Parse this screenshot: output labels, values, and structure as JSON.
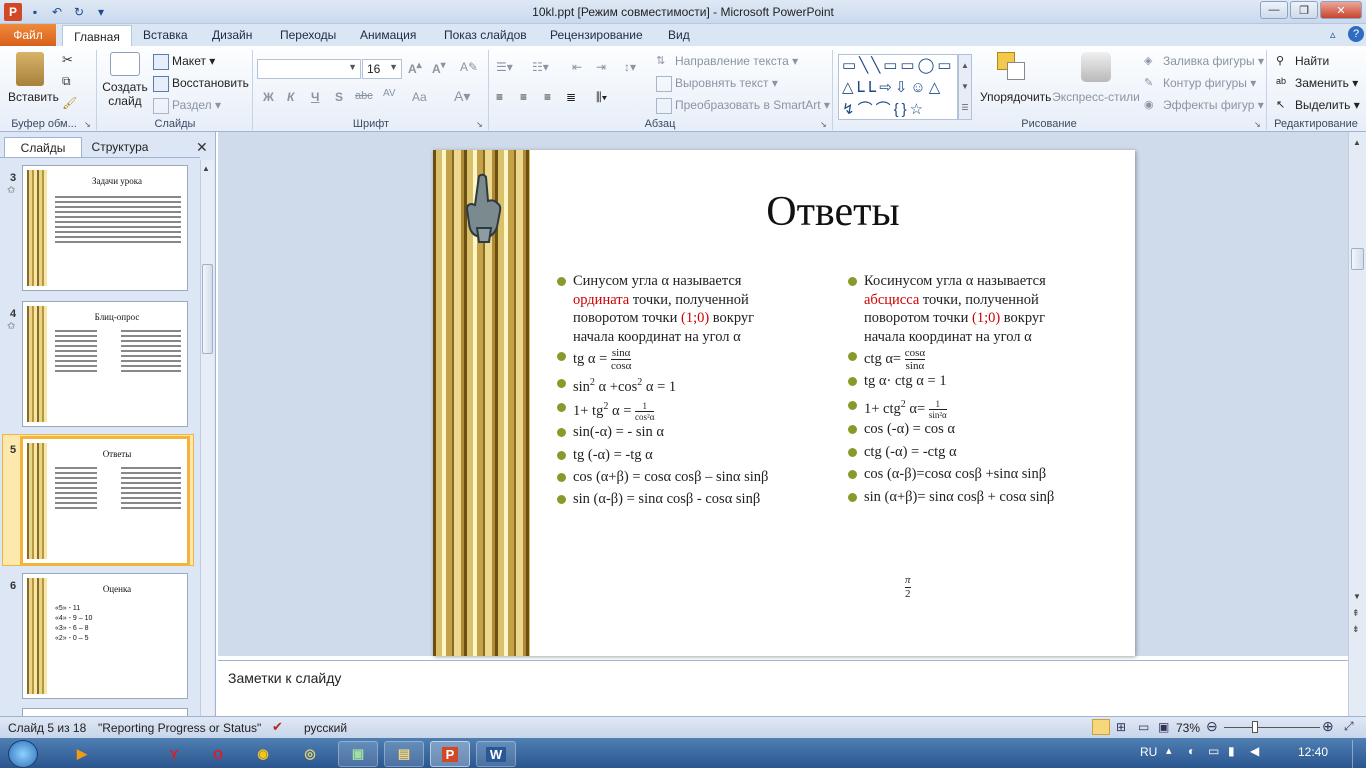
{
  "window": {
    "title": "10kl.ppt [Режим совместимости] - Microsoft PowerPoint"
  },
  "tabs": {
    "file": "Файл",
    "home": "Главная",
    "insert": "Вставка",
    "design": "Дизайн",
    "transitions": "Переходы",
    "animation": "Анимация",
    "slideshow": "Показ слайдов",
    "review": "Рецензирование",
    "view": "Вид"
  },
  "ribbon": {
    "clipboard": {
      "paste": "Вставить",
      "label": "Буфер обм..."
    },
    "slides": {
      "new_slide_1": "Создать",
      "new_slide_2": "слайд",
      "layout": "Макет",
      "reset": "Восстановить",
      "section": "Раздел",
      "label": "Слайды"
    },
    "font": {
      "size": "16",
      "bold": "Ж",
      "italic": "К",
      "underline": "Ч",
      "shadow": "S",
      "strike": "abc",
      "spacing": "AV",
      "case": "Aa",
      "label": "Шрифт"
    },
    "paragraph": {
      "text_direction": "Направление текста",
      "align_text": "Выровнять текст",
      "smartart": "Преобразовать в SmartArt",
      "label": "Абзац"
    },
    "drawing": {
      "arrange": "Упорядочить",
      "quick_styles": "Экспресс-стили",
      "fill": "Заливка фигуры",
      "outline": "Контур фигуры",
      "effects": "Эффекты фигур",
      "label": "Рисование"
    },
    "editing": {
      "find": "Найти",
      "replace": "Заменить",
      "select": "Выделить",
      "label": "Редактирование"
    }
  },
  "panel": {
    "tab_slides": "Слайды",
    "tab_outline": "Структура"
  },
  "thumbs": [
    {
      "num": "3",
      "title": "Задачи урока"
    },
    {
      "num": "4",
      "title": "Блиц-опрос"
    },
    {
      "num": "5",
      "title": "Ответы"
    },
    {
      "num": "6",
      "title": "Оценка",
      "lines": [
        "«5» - 11",
        "«4» - 9 – 10",
        "«3» - 6 – 8",
        "«2» - 0 – 5"
      ]
    }
  ],
  "slide": {
    "title": "Ответы",
    "left": [
      {
        "pre": "Синусом угла α называется ",
        "red": "ордината",
        "post": " точки, полученной поворотом точки ",
        "red2": "(1;0)",
        "post2": " вокруг начала координат на угол α"
      },
      "tg α = sinα / cosα",
      "sin² α +cos² α = 1",
      "1+ tg² α = 1/cos²α",
      "sin(-α) = - sin α",
      "tg (-α) = -tg α",
      "cos (α+β) = cosα cosβ – sinα sinβ",
      "sin (α-β) = sinα cosβ - cosα sinβ"
    ],
    "right": [
      {
        "pre": "Косинусом угла α называется ",
        "red": "абсцисса",
        "post": " точки, полученной поворотом точки ",
        "red2": "(1;0)",
        "post2": " вокруг начала координат на угол α"
      },
      "ctg α= cosα / sinα",
      "tg α· ctg α = 1",
      "1+ ctg² α= 1/sin²α",
      "cos (-α) = cos α",
      "ctg (-α) = -ctg α",
      "cos (α-β)=cosα cosβ +sinα sinβ",
      "sin (α+β)= sinα cosβ + cosα sinβ"
    ],
    "pi_over_2": {
      "num": "π",
      "den": "2"
    }
  },
  "notes": {
    "placeholder": "Заметки к слайду"
  },
  "status": {
    "slide_of": "Слайд 5 из 18",
    "theme": "\"Reporting Progress or Status\"",
    "language": "русский",
    "zoom": "73%"
  },
  "taskbar": {
    "lang": "RU",
    "time": "12:40"
  }
}
